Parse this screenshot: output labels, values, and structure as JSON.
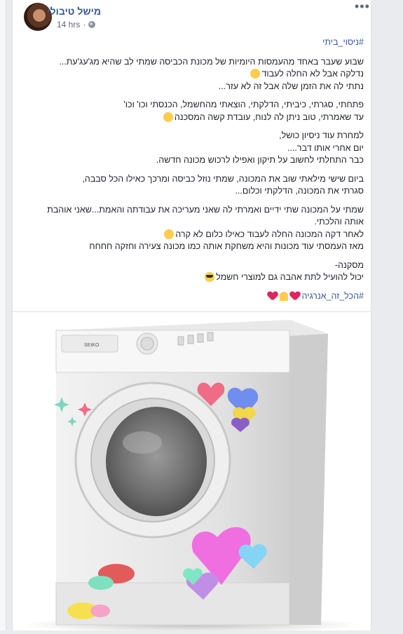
{
  "post": {
    "author": "מישל טיבולי",
    "time": "14 hrs",
    "more_label": "•••",
    "hashtag_top": "#ניסוי_ביתי",
    "paragraphs": [
      [
        "שבוע שעבר באחד מהעמסות היומיות של מכונת הכביסה שמתי לב שהיא מג'עג'עת...",
        "נדלקה אבל לא החלה לעבוד",
        "נתתי לה את הזמן שלה אבל זה לא עזר..."
      ],
      [
        "פתחתי, סגרתי, כיביתי, הדלקתי, הוצאתי מהחשמל, הכנסתי וכו' וכו'",
        "עד שאמרתי, טוב ניתן לה לנוח, עובדת קשה המסכנה"
      ],
      [
        "למחרת עוד ניסיון כושל,",
        "יום אחרי אותו דבר....",
        "כבר התחלתי לחשוב על תיקון ואפילו לרכוש מכונה חדשה."
      ],
      [
        "ביום שישי מילאתי שוב את המכונה, שמתי נוזל כביסה ומרכך כאילו הכל סבבה,",
        "סגרתי את המכונה, הדלקתי וכלום..."
      ],
      [
        "שמתי על המכונה שתי ידיים ואמרתי לה שאני מעריכה את עבודתה והאמת...שאני אוהבת",
        "אותה והלכתי.",
        "לאחר דקה המכונה החלה לעבוד כאילו כלום לא קרה",
        "מאז העמסתי עוד מכונות והיא משחקת אותה כמו מכונה צעירה וחזקה חחחח"
      ],
      [
        "מסקנה-",
        "יכול להועיל לתת אהבה גם למוצרי חשמל"
      ]
    ],
    "hashtag_bottom": "#הכל_זה_אנרגיה",
    "emoji": {
      "thinking": "thinking-face-icon",
      "laugh": "laughing-face-icon",
      "wink": "winking-face-icon",
      "sunglasses": "sunglasses-face-icon",
      "heart": "red-heart-icon",
      "pray": "folded-hands-icon"
    }
  },
  "image": {
    "brand_label": "SEIKO",
    "subject": "washing machine with hearts"
  },
  "colors": {
    "link": "#385898",
    "text": "#1d2129",
    "meta": "#616770",
    "background": "#e9ebee",
    "card": "#ffffff"
  }
}
